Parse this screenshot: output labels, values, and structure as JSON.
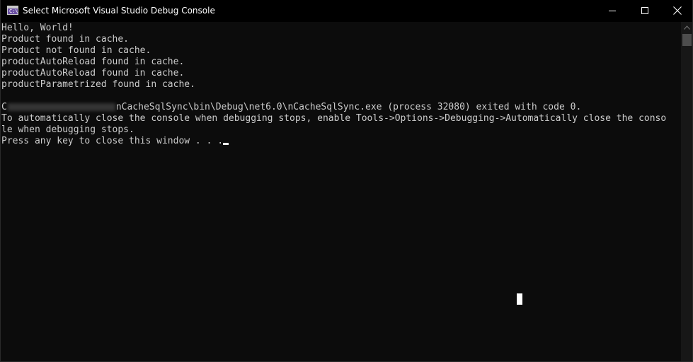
{
  "window": {
    "title": "Select Microsoft Visual Studio Debug Console",
    "icon": "console-app-icon",
    "icon_glyph": "C:\\",
    "controls": [
      "minimize-icon",
      "maximize-icon",
      "close-icon"
    ]
  },
  "console": {
    "lines": [
      "Hello, World!",
      "Product found in cache.",
      "Product not found in cache.",
      "productAutoReload found in cache.",
      "productAutoReload found in cache.",
      "productParametrized found in cache.",
      "",
      "",
      "To automatically close the console when debugging stops, enable Tools->Options->Debugging->Automatically close the conso",
      "le when debugging stops.",
      "Press any key to close this window . . ."
    ],
    "exit_line": {
      "prefix": "C",
      "suffix": "nCacheSqlSync\\bin\\Debug\\net6.0\\nCacheSqlSync.exe (process 32080) exited with code 0."
    }
  },
  "colors": {
    "background": "#0c0c0c",
    "text": "#cccccc",
    "titlebar": "#000000"
  }
}
